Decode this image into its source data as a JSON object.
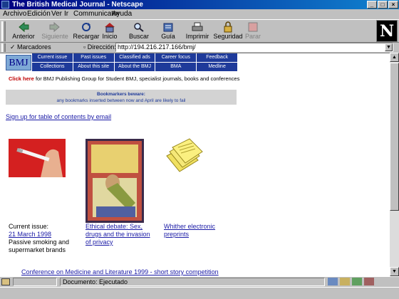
{
  "window": {
    "title": "The British Medical Journal - Netscape"
  },
  "menu": [
    "Archivo",
    "Edición",
    "Ver",
    "Ir",
    "Communicator",
    "Ayuda"
  ],
  "toolbar": [
    {
      "label": "Anterior",
      "icon": "back-arrow-icon",
      "disabled": false
    },
    {
      "label": "Siguiente",
      "icon": "forward-arrow-icon",
      "disabled": true
    },
    {
      "label": "Recargar",
      "icon": "reload-icon",
      "disabled": false
    },
    {
      "label": "Inicio",
      "icon": "home-icon",
      "disabled": false
    },
    {
      "label": "Buscar",
      "icon": "search-icon",
      "disabled": false
    },
    {
      "label": "Guía",
      "icon": "guide-icon",
      "disabled": false
    },
    {
      "label": "Imprimir",
      "icon": "print-icon",
      "disabled": false
    },
    {
      "label": "Seguridad",
      "icon": "security-lock-icon",
      "disabled": false
    },
    {
      "label": "Parar",
      "icon": "stop-icon",
      "disabled": true
    }
  ],
  "location": {
    "bookmarks_label": "Marcadores",
    "address_label": "Dirección:",
    "url": "http://194.216.217.166/bmj/"
  },
  "page": {
    "logo": "BMJ",
    "nav": [
      "Current issue",
      "Past issues",
      "Classified ads",
      "Career focus",
      "Feedback",
      "Collections",
      "About this site",
      "About the BMJ",
      "BMA",
      "Medline"
    ],
    "click_here_link": "Click here",
    "click_here_rest": " for BMJ Publishing Group for Student BMJ, specialist journals, books and conferences",
    "warning_line1": "Bookmarkers beware:",
    "warning_line2": "any bookmarks inserted between now and April are likely to fail",
    "signup": "Sign up for table of contents by email",
    "items": [
      {
        "pre": "Current issue:",
        "link": "21 March 1998",
        "post": "Passive smoking and supermarket brands"
      },
      {
        "link": "Ethical debate: Sex, drugs and the invasion of privacy"
      },
      {
        "link": "Whither electronic preprints"
      }
    ],
    "conference": "Conference on Medicine and Literature 1999 - short story competition"
  },
  "status": {
    "message": "Documento: Ejecutado"
  },
  "colors": {
    "nav_bg": "#1e3a9a",
    "titlebar": "#000080",
    "link": "#1a1aa6"
  }
}
